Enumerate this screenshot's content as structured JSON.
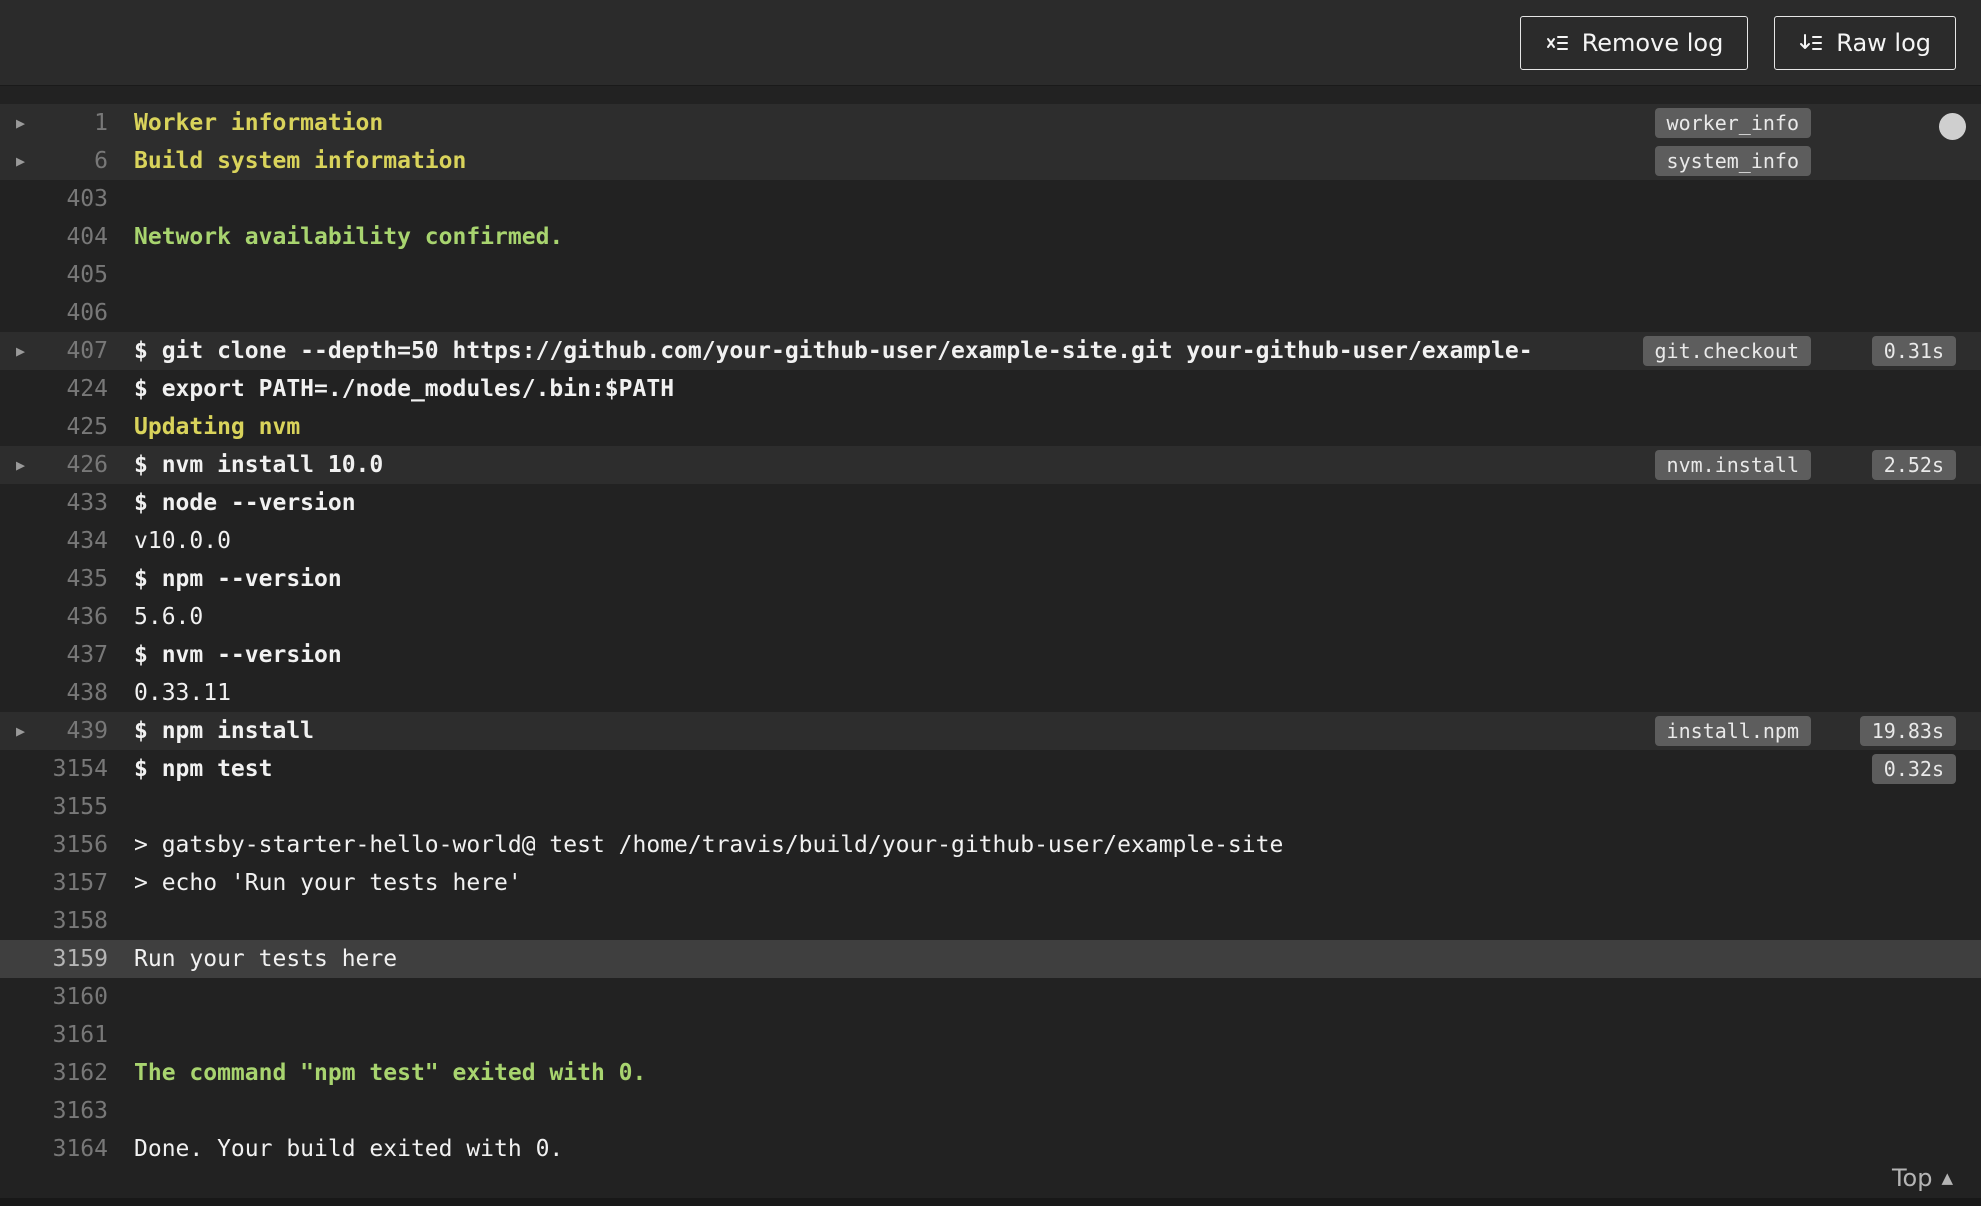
{
  "header": {
    "buttons": [
      {
        "label": "Remove log",
        "icon": "remove-log-icon"
      },
      {
        "label": "Raw log",
        "icon": "raw-log-icon"
      }
    ]
  },
  "log_lines": [
    {
      "number": "1",
      "text": "Worker information",
      "style": "yellow",
      "fold": true,
      "highlight": true,
      "badge": "worker_info"
    },
    {
      "number": "6",
      "text": "Build system information",
      "style": "yellow",
      "fold": true,
      "highlight": true,
      "badge": "system_info"
    },
    {
      "number": "403",
      "text": ""
    },
    {
      "number": "404",
      "text": "Network availability confirmed.",
      "style": "green"
    },
    {
      "number": "405",
      "text": ""
    },
    {
      "number": "406",
      "text": ""
    },
    {
      "number": "407",
      "text": "$ git clone --depth=50 https://github.com/your-github-user/example-site.git your-github-user/example-",
      "style": "command",
      "fold": true,
      "highlight": true,
      "badge": "git.checkout",
      "time": "0.31s"
    },
    {
      "number": "424",
      "text": "$ export PATH=./node_modules/.bin:$PATH",
      "style": "command"
    },
    {
      "number": "425",
      "text": "Updating nvm",
      "style": "yellow"
    },
    {
      "number": "426",
      "text": "$ nvm install 10.0",
      "style": "command",
      "fold": true,
      "highlight": true,
      "badge": "nvm.install",
      "time": "2.52s"
    },
    {
      "number": "433",
      "text": "$ node --version",
      "style": "command"
    },
    {
      "number": "434",
      "text": "v10.0.0"
    },
    {
      "number": "435",
      "text": "$ npm --version",
      "style": "command"
    },
    {
      "number": "436",
      "text": "5.6.0"
    },
    {
      "number": "437",
      "text": "$ nvm --version",
      "style": "command"
    },
    {
      "number": "438",
      "text": "0.33.11"
    },
    {
      "number": "439",
      "text": "$ npm install",
      "style": "command",
      "fold": true,
      "highlight": true,
      "badge": "install.npm",
      "time": "19.83s"
    },
    {
      "number": "3154",
      "text": "$ npm test",
      "style": "command",
      "time": "0.32s"
    },
    {
      "number": "3155",
      "text": ""
    },
    {
      "number": "3156",
      "text": "> gatsby-starter-hello-world@ test /home/travis/build/your-github-user/example-site"
    },
    {
      "number": "3157",
      "text": "> echo 'Run your tests here'"
    },
    {
      "number": "3158",
      "text": ""
    },
    {
      "number": "3159",
      "text": "Run your tests here",
      "selected": true
    },
    {
      "number": "3160",
      "text": ""
    },
    {
      "number": "3161",
      "text": ""
    },
    {
      "number": "3162",
      "text": "The command \"npm test\" exited with 0.",
      "style": "green"
    },
    {
      "number": "3163",
      "text": ""
    },
    {
      "number": "3164",
      "text": "Done. Your build exited with 0."
    }
  ],
  "footer": {
    "top_label": "Top"
  },
  "colors": {
    "background": "#222222",
    "yellow": "#d9d35b",
    "green": "#a8d46f",
    "badge_bg": "#5d5d5d"
  }
}
